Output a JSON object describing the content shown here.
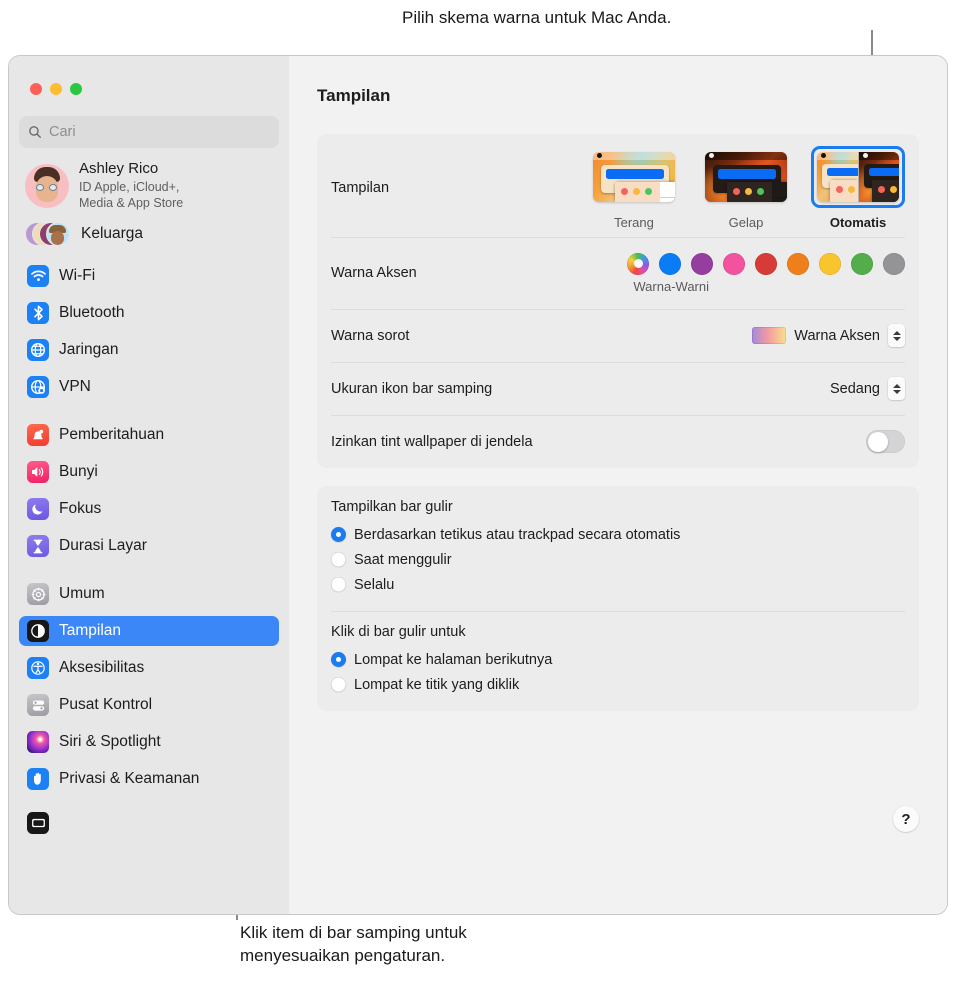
{
  "callouts": {
    "top": "Pilih skema warna untuk Mac Anda.",
    "bottom_line1": "Klik item di bar samping untuk",
    "bottom_line2": "menyesuaikan pengaturan."
  },
  "window": {
    "traffic_lights": [
      "close",
      "minimize",
      "zoom"
    ]
  },
  "sidebar": {
    "search": {
      "placeholder": "Cari",
      "value": "",
      "icon": "search-icon"
    },
    "account": {
      "name": "Ashley Rico",
      "subtitle_line1": "ID Apple, iCloud+,",
      "subtitle_line2": "Media & App Store"
    },
    "family": {
      "label": "Keluarga",
      "icon": "family-avatars-icon"
    },
    "groups": [
      {
        "items": [
          {
            "label": "Wi-Fi",
            "icon": "wifi-icon",
            "selected": false
          },
          {
            "label": "Bluetooth",
            "icon": "bluetooth-icon",
            "selected": false
          },
          {
            "label": "Jaringan",
            "icon": "network-globe-icon",
            "selected": false
          },
          {
            "label": "VPN",
            "icon": "vpn-globe-icon",
            "selected": false
          }
        ]
      },
      {
        "items": [
          {
            "label": "Pemberitahuan",
            "icon": "notifications-bell-icon",
            "selected": false
          },
          {
            "label": "Bunyi",
            "icon": "sound-speaker-icon",
            "selected": false
          },
          {
            "label": "Fokus",
            "icon": "focus-moon-icon",
            "selected": false
          },
          {
            "label": "Durasi Layar",
            "icon": "screen-time-hourglass-icon",
            "selected": false
          }
        ]
      },
      {
        "items": [
          {
            "label": "Umum",
            "icon": "general-gear-icon",
            "selected": false
          },
          {
            "label": "Tampilan",
            "icon": "appearance-icon",
            "selected": true
          },
          {
            "label": "Aksesibilitas",
            "icon": "accessibility-icon",
            "selected": false
          },
          {
            "label": "Pusat Kontrol",
            "icon": "control-center-icon",
            "selected": false
          },
          {
            "label": "Siri & Spotlight",
            "icon": "siri-icon",
            "selected": false
          },
          {
            "label": "Privasi & Keamanan",
            "icon": "privacy-hand-icon",
            "selected": false
          }
        ]
      }
    ]
  },
  "content": {
    "page_title": "Tampilan",
    "appearance": {
      "label": "Tampilan",
      "options": [
        {
          "label": "Terang",
          "selected": false
        },
        {
          "label": "Gelap",
          "selected": false
        },
        {
          "label": "Otomatis",
          "selected": true
        }
      ]
    },
    "accent": {
      "label": "Warna Aksen",
      "caption": "Warna-Warni",
      "swatches": [
        {
          "name": "multicolor",
          "color": "multicolor",
          "selected": true
        },
        {
          "name": "blue",
          "color": "#0a7cf5"
        },
        {
          "name": "purple",
          "color": "#963da0"
        },
        {
          "name": "pink",
          "color": "#f2529f"
        },
        {
          "name": "red",
          "color": "#d63b38"
        },
        {
          "name": "orange",
          "color": "#ef7f1b"
        },
        {
          "name": "yellow",
          "color": "#f8c62c"
        },
        {
          "name": "green",
          "color": "#52ad4a"
        },
        {
          "name": "graphite",
          "color": "#949497"
        }
      ]
    },
    "highlight": {
      "label": "Warna sorot",
      "value": "Warna Aksen"
    },
    "sidebar_icon_size": {
      "label": "Ukuran ikon bar samping",
      "value": "Sedang"
    },
    "wallpaper_tint": {
      "label": "Izinkan tint wallpaper di jendela",
      "on": false
    },
    "show_scroll_bars": {
      "title": "Tampilkan bar gulir",
      "options": [
        {
          "label": "Berdasarkan tetikus atau trackpad secara otomatis",
          "selected": true
        },
        {
          "label": "Saat menggulir",
          "selected": false
        },
        {
          "label": "Selalu",
          "selected": false
        }
      ]
    },
    "click_scroll_bar": {
      "title": "Klik di bar gulir untuk",
      "options": [
        {
          "label": "Lompat ke halaman berikutnya",
          "selected": true
        },
        {
          "label": "Lompat ke titik yang diklik",
          "selected": false
        }
      ]
    },
    "help_button": "?"
  },
  "colors": {
    "accent_blue": "#3b87f7",
    "window_bg": "#f2f2f2",
    "sidebar_bg": "#e7e7e7",
    "card_bg": "#ececec"
  }
}
